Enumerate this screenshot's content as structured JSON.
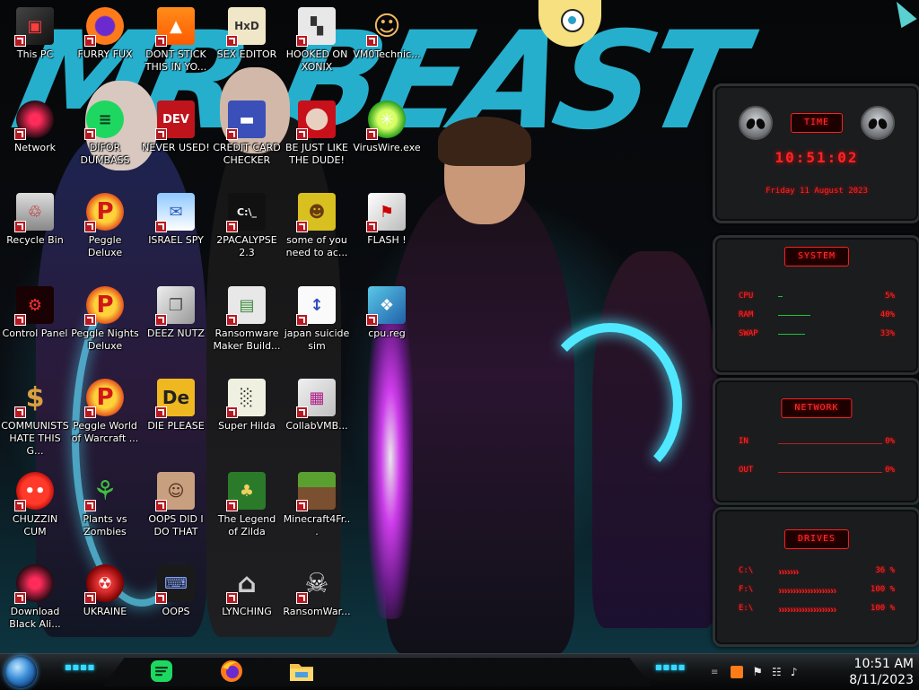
{
  "desktop": {
    "icons": [
      {
        "label": "This PC",
        "kind": "this-pc"
      },
      {
        "label": "FURRY FUX",
        "kind": "firefox"
      },
      {
        "label": "DONT STICK THIS IN YO...",
        "kind": "vlc"
      },
      {
        "label": "SEX EDITOR",
        "kind": "hex-editor"
      },
      {
        "label": "HOOKED ON XONIX",
        "kind": "xonix"
      },
      {
        "label": "VM0Technic...",
        "kind": "technician"
      },
      {
        "label": "Network",
        "kind": "network"
      },
      {
        "label": "DIFOR DUMBASS",
        "kind": "discord"
      },
      {
        "label": "NEVER USED!",
        "kind": "dev-cpp"
      },
      {
        "label": "CREDIT CARD CHECKER",
        "kind": "credit-card"
      },
      {
        "label": "BE JUST LIKE THE DUDE!",
        "kind": "santa"
      },
      {
        "label": "VirusWire.exe",
        "kind": "lime"
      },
      {
        "label": "Recycle Bin",
        "kind": "recycle-bin"
      },
      {
        "label": "Peggle Deluxe",
        "kind": "peggle"
      },
      {
        "label": "ISRAEL SPY",
        "kind": "spy"
      },
      {
        "label": "2PACALYPSE 2.3",
        "kind": "terminal"
      },
      {
        "label": "some of you need to ac...",
        "kind": "beaver"
      },
      {
        "label": "FLASH !",
        "kind": "flash"
      },
      {
        "label": "Control Panel",
        "kind": "control-panel"
      },
      {
        "label": "Peggle Nights Deluxe",
        "kind": "peggle"
      },
      {
        "label": "DEEZ NUTZ",
        "kind": "windows"
      },
      {
        "label": "Ransomware Maker Build...",
        "kind": "app-window"
      },
      {
        "label": "japan suicide sim",
        "kind": "document"
      },
      {
        "label": "cpu.reg",
        "kind": "registry"
      },
      {
        "label": "COMMUNISTS HATE THIS G...",
        "kind": "money-bag"
      },
      {
        "label": "Peggle World of Warcraft ...",
        "kind": "peggle"
      },
      {
        "label": "DIE PLEASE",
        "kind": "de"
      },
      {
        "label": "Super Hilda",
        "kind": "pixel-art"
      },
      {
        "label": "CollabVMB...",
        "kind": "collabvm"
      },
      {
        "label": "CHUZZIN CUM",
        "kind": "chuzzle"
      },
      {
        "label": "Plants vs Zombies",
        "kind": "pvz"
      },
      {
        "label": "OOPS DID I DO THAT",
        "kind": "portrait"
      },
      {
        "label": "The Legend of Zilda",
        "kind": "zelda"
      },
      {
        "label": "Minecraft4Fr...",
        "kind": "minecraft"
      },
      {
        "label": "Download Black Ali...",
        "kind": "alienware"
      },
      {
        "label": "UKRAINE",
        "kind": "radiation"
      },
      {
        "label": "OOPS",
        "kind": "oops"
      },
      {
        "label": "LYNCHING",
        "kind": "lynching"
      },
      {
        "label": "RansomWar...",
        "kind": "skull"
      }
    ]
  },
  "wallpaper": {
    "text": "MR BEAST"
  },
  "gadgets": {
    "time": {
      "title": "TIME",
      "clock": "10:51:02",
      "date": "Friday 11 August 2023"
    },
    "system": {
      "title": "SYSTEM",
      "rows": [
        {
          "label": "CPU",
          "value": "5%",
          "pct": 5
        },
        {
          "label": "RAM",
          "value": "40%",
          "pct": 40
        },
        {
          "label": "SWAP",
          "value": "33%",
          "pct": 33
        }
      ]
    },
    "network": {
      "title": "NETWORK",
      "rows": [
        {
          "label": "IN",
          "value": "0%"
        },
        {
          "label": "OUT",
          "value": "0%"
        }
      ]
    },
    "drives": {
      "title": "DRIVES",
      "rows": [
        {
          "label": "C:\\",
          "value": "36 %"
        },
        {
          "label": "F:\\",
          "value": "100 %"
        },
        {
          "label": "E:\\",
          "value": "100 %"
        }
      ]
    }
  },
  "taskbar": {
    "pinned": [
      {
        "kind": "discord"
      },
      {
        "kind": "firefox"
      },
      {
        "kind": "file-explorer"
      }
    ],
    "tray_icons": [
      "fl-studio-icon",
      "flag-icon",
      "network-icon",
      "volume-icon"
    ],
    "clock_time": "10:51 AM",
    "clock_date": "8/11/2023"
  },
  "colors": {
    "accent_red": "#ff2424",
    "accent_cyan": "#28b8d8",
    "orb_blue": "#3c8fd8"
  }
}
